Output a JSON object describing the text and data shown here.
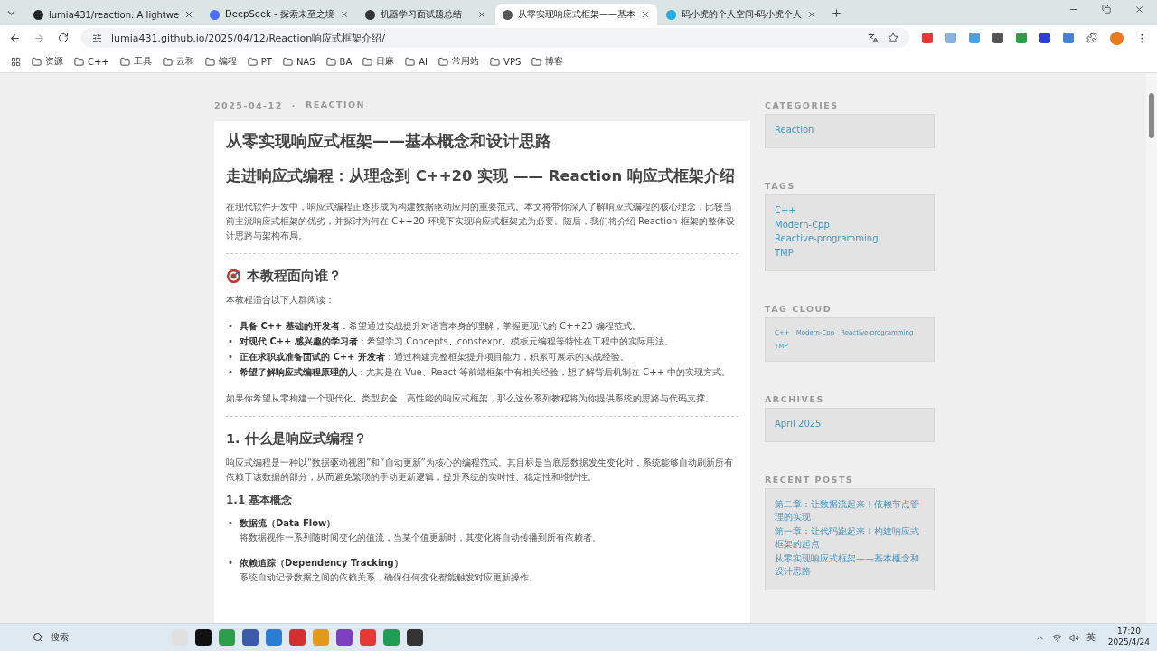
{
  "browser": {
    "tabs": [
      {
        "title": "lumia431/reaction: A lightwe",
        "selected": false,
        "color": "#222222"
      },
      {
        "title": "DeepSeek - 探索未至之境",
        "selected": false,
        "color": "#4d6bfe"
      },
      {
        "title": "机器学习面试题总结",
        "selected": false,
        "color": "#333333"
      },
      {
        "title": "从零实现响应式框架——基本",
        "selected": true,
        "color": "#555555"
      },
      {
        "title": "码小虎的个人空间-码小虎个人",
        "selected": false,
        "color": "#23ade5"
      }
    ],
    "url": "lumia431.github.io/2025/04/12/Reaction响应式框架介绍/",
    "bookmarks": [
      "资源",
      "C++",
      "工具",
      "云和",
      "编程",
      "PT",
      "NAS",
      "BA",
      "日麻",
      "AI",
      "常用站",
      "VPS",
      "博客"
    ]
  },
  "post": {
    "date": "2025-04-12",
    "separator": "·",
    "category": "REACTION",
    "title": "从零实现响应式框架——基本概念和设计思路",
    "subtitle": "走进响应式编程：从理念到 C++20 实现 —— Reaction 响应式框架介绍",
    "blocks": [
      {
        "kind": "p",
        "text": "在现代软件开发中，响应式编程正逐步成为构建数据驱动应用的重要范式。本文将带你深入了解响应式编程的核心理念，比较当前主流响应式框架的优劣，并探讨为何在 C++20 环境下实现响应式框架尤为必要。随后，我们将介绍 Reaction 框架的整体设计思路与架构布局。"
      },
      {
        "kind": "hr"
      },
      {
        "kind": "icon-heading",
        "text": "本教程面向谁？"
      },
      {
        "kind": "p",
        "text": "本教程适合以下人群阅读："
      },
      {
        "kind": "ul",
        "marker": "•",
        "items": [
          "**具备 C++ 基础的开发者**：希望通过实战提升对语言本身的理解，掌握更现代的 C++20 编程范式。",
          "**对现代 C++ 感兴趣的学习者**：希望学习 Concepts、constexpr、模板元编程等特性在工程中的实际用法。",
          "**正在求职或准备面试的 C++ 开发者**：通过构建完整框架提升项目能力，积累可展示的实战经验。",
          "**希望了解响应式编程原理的人**：尤其是在 Vue、React 等前端框架中有相关经验，想了解背后机制在 C++ 中的实现方式。"
        ]
      },
      {
        "kind": "p",
        "text": "如果你希望从零构建一个现代化、类型安全、高性能的响应式框架，那么这份系列教程将为你提供系统的思路与代码支撑。"
      },
      {
        "kind": "hr"
      },
      {
        "kind": "heading",
        "text": "1. 什么是响应式编程？"
      },
      {
        "kind": "p",
        "text": "响应式编程是一种以“数据驱动视图”和“自动更新”为核心的编程范式。其目标是当底层数据发生变化时，系统能够自动刷新所有依赖于该数据的部分，从而避免繁琐的手动更新逻辑，提升系统的实时性、稳定性和维护性。"
      },
      {
        "kind": "subheading",
        "text": "1.1 基本概念"
      },
      {
        "kind": "terms",
        "marker": "•",
        "items": [
          {
            "term": "数据流（Data Flow）",
            "text": "将数据视作一系列随时间变化的值流，当某个值更新时，其变化将自动传播到所有依赖者。"
          },
          {
            "term": "依赖追踪（Dependency Tracking）",
            "text": "系统自动记录数据之间的依赖关系，确保任何变化都能触发对应更新操作。"
          }
        ]
      }
    ]
  },
  "sidebar": [
    {
      "heading": "CATEGORIES",
      "kind": "list",
      "items": [
        "Reaction"
      ]
    },
    {
      "heading": "TAGS",
      "kind": "list",
      "items": [
        "C++",
        "Modern-Cpp",
        "Reactive-programming",
        "TMP"
      ]
    },
    {
      "heading": "TAG CLOUD",
      "kind": "cloud",
      "items": [
        "C++",
        "Modern-Cpp",
        "Reactive-programming",
        "TMP"
      ]
    },
    {
      "heading": "ARCHIVES",
      "kind": "list",
      "items": [
        "April 2025"
      ]
    },
    {
      "heading": "RECENT POSTS",
      "kind": "list",
      "items": [
        "第二章：让数据流起来！依赖节点管理的实现",
        "第一章：让代码跑起来！构建响应式框架的起点",
        "从零实现响应式框架——基本概念和设计思路"
      ]
    }
  ],
  "taskbar": {
    "search_placeholder": "搜索",
    "ime": "英",
    "time": "17:20",
    "date": "2025/4/24"
  }
}
